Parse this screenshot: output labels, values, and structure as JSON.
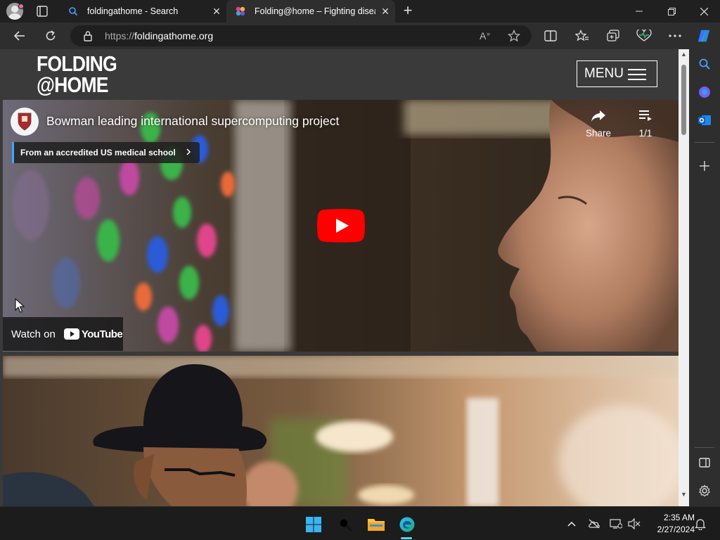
{
  "browser": {
    "tabs": [
      {
        "title": "foldingathome - Search",
        "active": false
      },
      {
        "title": "Folding@home – Fighting diseas",
        "active": true
      }
    ],
    "new_tab_label": "+",
    "address": {
      "scheme": "https://",
      "host": "foldingathome.org"
    },
    "window_controls": [
      "minimize",
      "restore",
      "close"
    ],
    "sidebar_icons": [
      "search-icon",
      "copilot-icon",
      "outlook-icon",
      "add-icon",
      "sidebar-toggle-icon",
      "settings-icon"
    ]
  },
  "site": {
    "logo_line1": "FOLDING",
    "logo_line2": "@HOME",
    "menu_label": "MENU"
  },
  "video": {
    "title": "Bowman leading international supercomputing project",
    "chip": "From an accredited US medical school",
    "share_label": "Share",
    "playlist_count": "1/1",
    "watch_on": "Watch on",
    "youtube_word": "YouTube"
  },
  "taskbar": {
    "time": "2:35 AM",
    "date": "2/27/2024"
  },
  "colors": {
    "page_bg": "#3a3a3a",
    "chrome_bg": "#202020",
    "toolbar_bg": "#2e2e2e",
    "youtube_red": "#ff0000",
    "accent_blue": "#3ea6ff"
  }
}
